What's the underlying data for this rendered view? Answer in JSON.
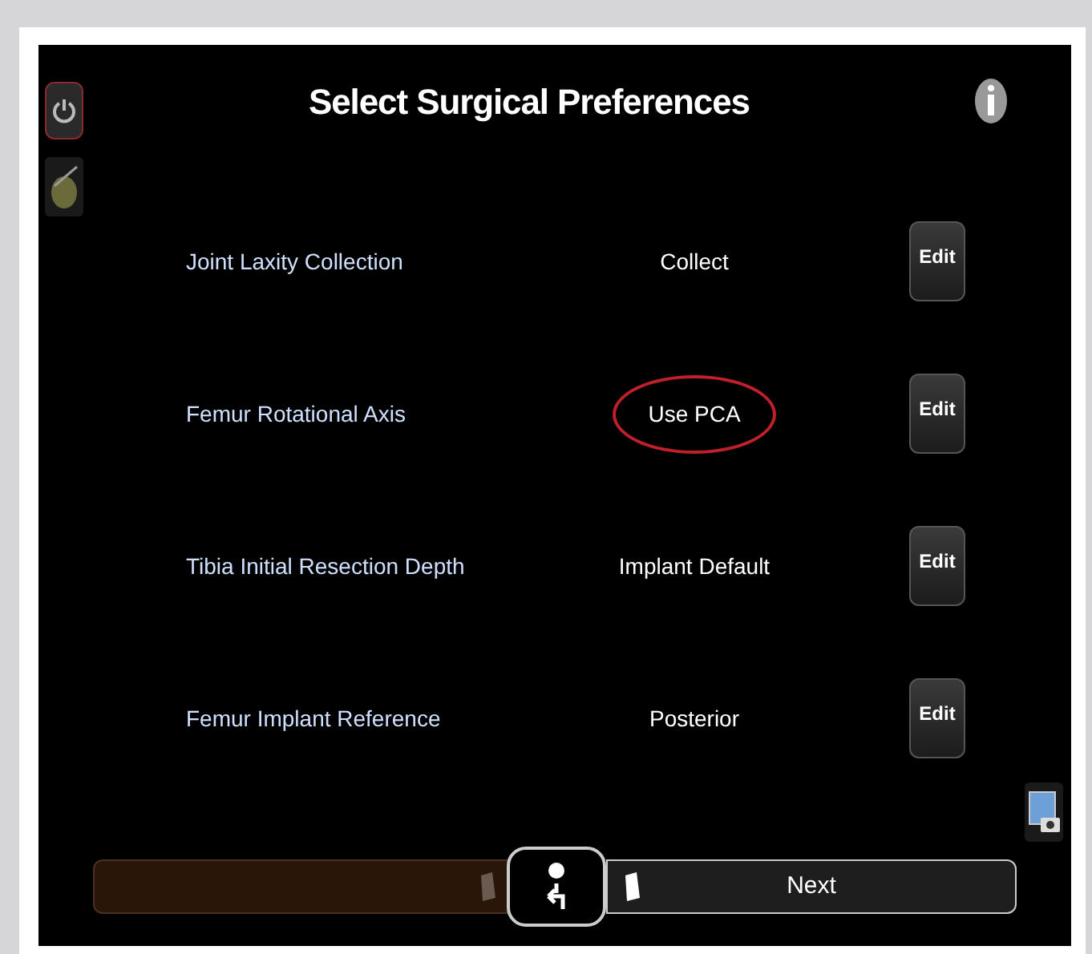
{
  "header": {
    "title": "Select Surgical Preferences"
  },
  "preferences": [
    {
      "label": "Joint Laxity Collection",
      "value": "Collect",
      "circled": false,
      "button": "Edit"
    },
    {
      "label": "Femur Rotational Axis",
      "value": "Use PCA",
      "circled": true,
      "button": "Edit"
    },
    {
      "label": "Tibia Initial Resection Depth",
      "value": "Implant Default",
      "circled": false,
      "button": "Edit"
    },
    {
      "label": "Femur Implant Reference",
      "value": "Posterior",
      "circled": false,
      "button": "Edit"
    }
  ],
  "slider": {
    "label": "Next"
  }
}
